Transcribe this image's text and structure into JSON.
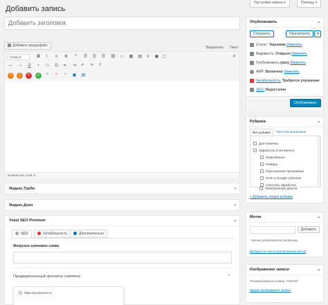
{
  "top_buttons": {
    "screen_options": "Настройки экрана ▾",
    "help": "Помощь ▾"
  },
  "page_title": "Добавить запись",
  "title_placeholder": "Добавить заголовок",
  "editor": {
    "add_media": "Добавить медиафайл",
    "tab_visual": "Визуально",
    "tab_text": "Текст",
    "format_select": "Абзац",
    "word_count": "Количество слов: 0"
  },
  "boxes": {
    "yandex_turbo": "Яндекс.Турбо",
    "yandex_zen": "Яндекс.Дзен",
    "yoast_title": "Yoast SEO Premium",
    "yoast_tabs": [
      "SEO",
      "Читабельность",
      "Дополнительно"
    ],
    "focus_keyword_label": "Фокусное ключевое слово",
    "snippet_preview": "Предварительный просмотр сниппета",
    "snippet_url": "https://prodvinem.ru"
  },
  "publish": {
    "title": "Опубликовать",
    "save": "Сохранить",
    "preview": "Просмотреть",
    "status_label": "Статус:",
    "status_value": "Черновик",
    "visibility_label": "Видимость:",
    "visibility_value": "Открыто",
    "publish_label": "Опубликовать",
    "publish_value": "сразу",
    "amp_label": "AMP:",
    "amp_value": "Включено",
    "readability_label": "Читабельность:",
    "readability_value": "Требуется улучшение",
    "seo_label": "SEO:",
    "seo_value": "Недоступно",
    "edit_link": "Изменить",
    "publish_button": "Опубликовать"
  },
  "categories": {
    "title": "Рубрики",
    "tab_all": "Все рубрики",
    "tab_popular": "Часто используемые",
    "items": [
      "Для новичка",
      "Заработок в интернете",
      "Инфобизнес",
      "Кнайдж",
      "Партнерские программы",
      "PCR и Google AdSense",
      "Способы заработка",
      "Электронные деньги"
    ],
    "add_link": "+ Добавить новую рубрику"
  },
  "tags": {
    "title": "Метки",
    "add_button": "Добавить",
    "hint": "Метки разделяются запятыми.",
    "choose_link": "Выбрать из часто используемых меток"
  },
  "featured_image": {
    "title": "Изображение записи",
    "recommended": "Рекомендуемый размер 770х330",
    "set_link": "Задать изображение записи"
  },
  "colors": {
    "accent": "#0073aa",
    "primary_button": "#0085ba"
  }
}
